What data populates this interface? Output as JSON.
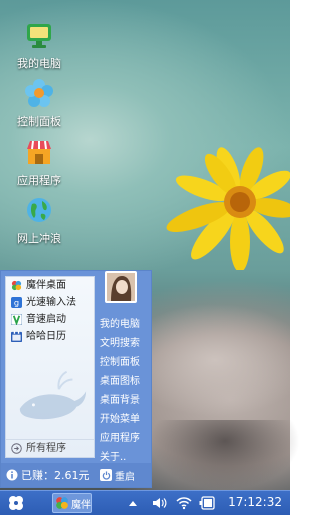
{
  "desktop": {
    "icons": [
      {
        "label": "我的电脑",
        "icon": "computer-icon"
      },
      {
        "label": "控制面板",
        "icon": "control-panel-icon"
      },
      {
        "label": "应用程序",
        "icon": "store-icon"
      },
      {
        "label": "网上冲浪",
        "icon": "globe-icon"
      }
    ]
  },
  "start_menu": {
    "left_items": [
      {
        "label": "魔伴桌面",
        "icon": "pinwheel-icon"
      },
      {
        "label": "光速输入法",
        "icon": "input-method-icon"
      },
      {
        "label": "音速启动",
        "icon": "launcher-icon"
      },
      {
        "label": "哈哈日历",
        "icon": "calendar-icon"
      }
    ],
    "all_programs": "所有程序",
    "right_items": [
      {
        "label": "我的电脑"
      },
      {
        "label": "文明搜索"
      },
      {
        "label": "控制面板"
      },
      {
        "label": "桌面图标"
      },
      {
        "label": "桌面背景"
      },
      {
        "label": "开始菜单"
      },
      {
        "label": "应用程序"
      },
      {
        "label": "关于.."
      }
    ],
    "earned": "已赚：2.61元",
    "restart": "重启"
  },
  "taskbar": {
    "task_label": "魔伴",
    "clock": "17:12:32"
  },
  "colors": {
    "menu_blue": "#6a93d8",
    "taskbar_blue": "#2d5db4",
    "flower_yellow": "#f5d21a"
  }
}
